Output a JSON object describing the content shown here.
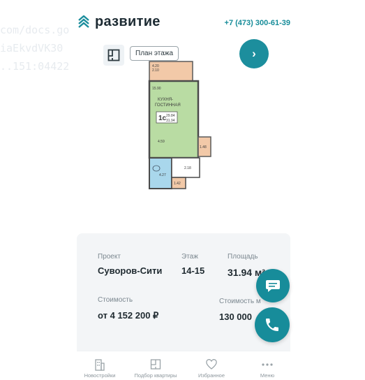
{
  "background": {
    "lines": [
      "com/docs.go",
      "iaEkvdVK30",
      "..151:04422"
    ]
  },
  "header": {
    "brand": "развитие",
    "phone": "+7 (473) 300-61-39"
  },
  "plan": {
    "view_button_label": "План этажа",
    "next_icon": "chevron-right-icon",
    "room_labels": {
      "balcony": "4.20\n2.10",
      "hall_top": "15.90",
      "kitchen": "КУХНЯ-\nГОСТИННАЯ",
      "type": "1с",
      "area_living": "29.84",
      "area_total": "31.94",
      "zone": "4.59",
      "closet": "1.48",
      "bath": "4.27",
      "corridor": "2.18",
      "wc": "1.42"
    }
  },
  "details": {
    "project_label": "Проект",
    "project_value": "Суворов-Сити",
    "floor_label": "Этаж",
    "floor_value": "14-15",
    "area_label": "Площадь",
    "area_value": "31.94 м²",
    "price_label": "Стоимость",
    "price_value": "от 4 152 200 ₽",
    "price_m_label": "Стоимость м",
    "price_m_value": "130 000"
  },
  "fabs": {
    "chat_icon": "chat-icon",
    "call_icon": "phone-icon"
  },
  "nav": {
    "items": [
      {
        "label": "Новостройки",
        "icon": "building-icon"
      },
      {
        "label": "Подбор квартиры",
        "icon": "floorplan-icon"
      },
      {
        "label": "Избранное",
        "icon": "heart-icon"
      },
      {
        "label": "Меню",
        "icon": "more-icon"
      }
    ]
  },
  "colors": {
    "accent": "#178c9a",
    "kitchen_fill": "#b9dca3",
    "balcony_fill": "#f2c9a8",
    "bath_fill": "#a9d7ec"
  }
}
